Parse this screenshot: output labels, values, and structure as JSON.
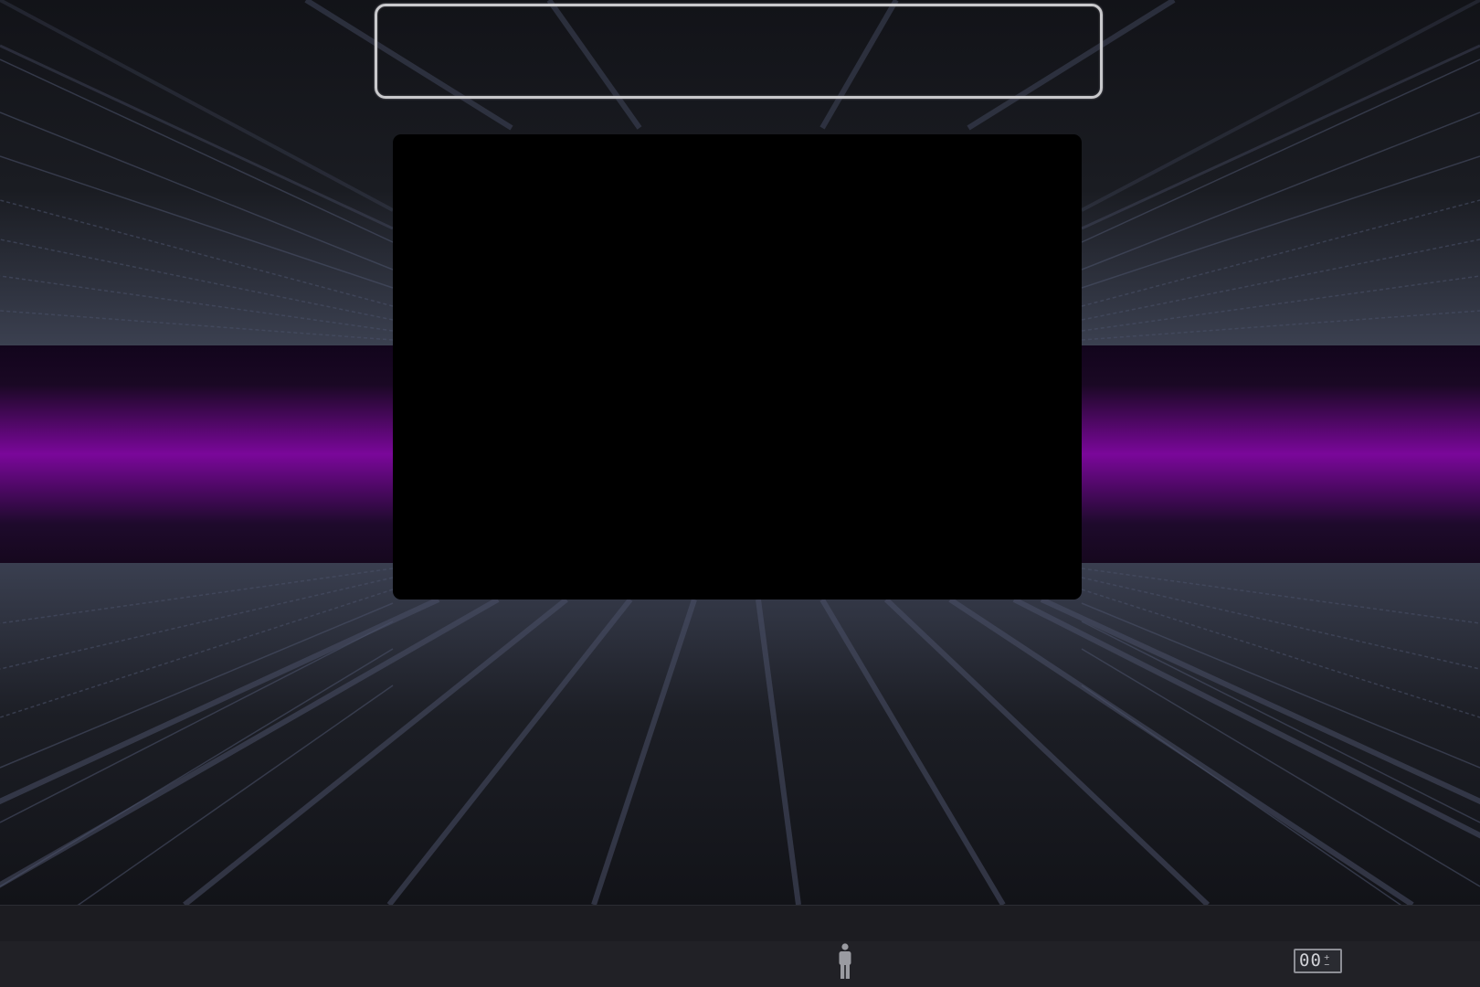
{
  "scene": {
    "colors": {
      "background": "#121318",
      "floor_glow": "#3a3f50",
      "grid_line": "#4a5068",
      "band_dark": "#1a0824",
      "band_bright": "#7a079a",
      "title_frame_border": "#c9c9cc",
      "screen": "#000000",
      "footer": "#1c1c21",
      "bottom_bar": "#212126"
    },
    "title_frame": {
      "text": ""
    },
    "video_screen": {
      "state": "blank"
    }
  },
  "bottom_bar": {
    "viewer_icon": "person-icon",
    "counter": {
      "digits": "00",
      "increment_icon": "plus-icon",
      "decrement_icon": "minus-icon",
      "increment_symbol": "+",
      "decrement_symbol": "−"
    }
  }
}
